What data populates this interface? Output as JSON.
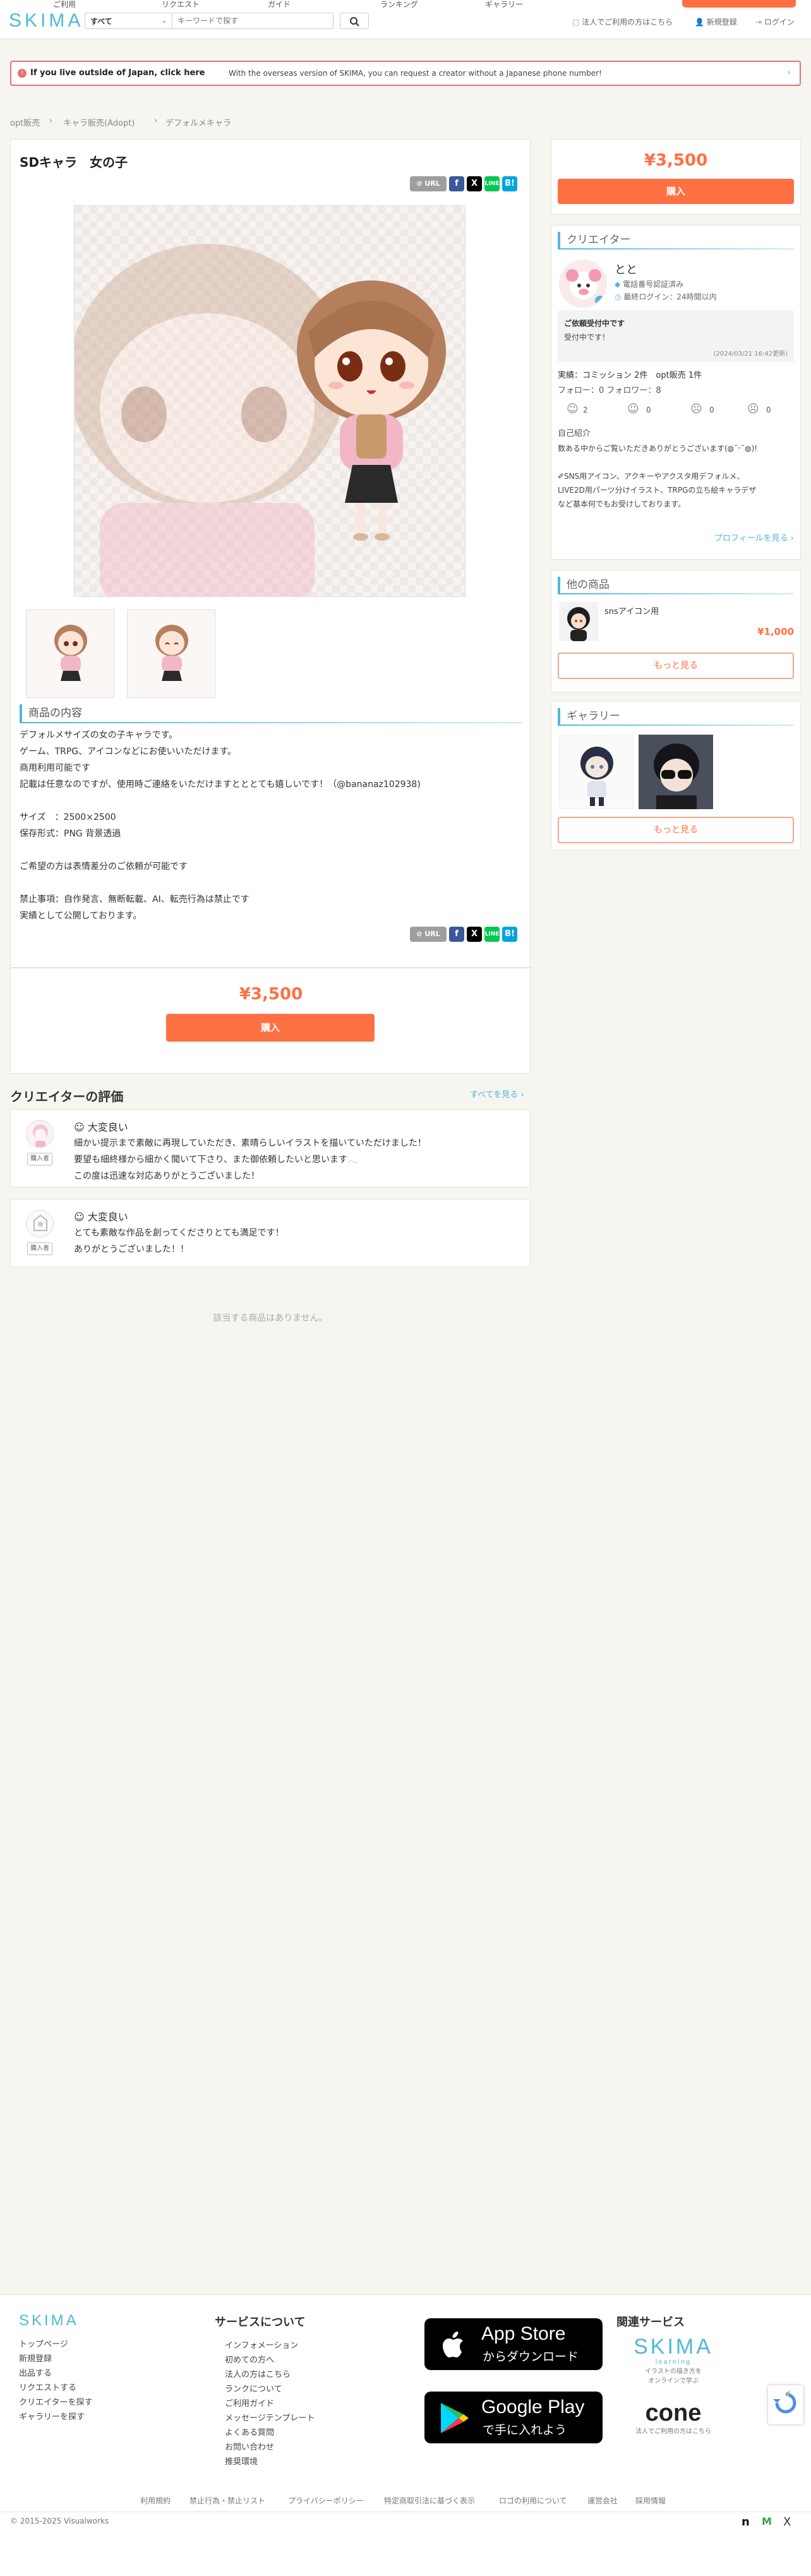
{
  "header": {
    "top_links": [
      "ご利用",
      "リクエスト",
      "ガイド",
      "ランキング",
      "ギャラリー"
    ],
    "logo": "SKIMA",
    "category_value": "すべて",
    "search_placeholder": "キーワードで探す",
    "corporate_link": "法人でご利用の方はこちら",
    "register_link": "新規登録",
    "login_link": "ログイン"
  },
  "banner": {
    "strong": "If you live outside of Japan, click here",
    "text": "With the overseas version of SKIMA, you can request a creator without a Japanese phone number!"
  },
  "breadcrumb": [
    "opt販売",
    "キャラ販売(Adopt)",
    "デフォルメキャラ"
  ],
  "product": {
    "title": "SDキャラ　女の子",
    "url_label": "URL",
    "section_title": "商品の内容",
    "description": [
      "デフォルメサイズの女の子キャラです。",
      "ゲーム、TRPG、アイコンなどにお使いいただけます。",
      "商用利用可能です",
      "記載は任意なのですが、使用時ご連絡をいただけますとととても嬉しいです！（@bananaz102938)",
      "",
      "サイズ　：2500×2500",
      "保存形式：PNG 背景透過",
      "",
      "ご希望の方は表情差分のご依頼が可能です",
      "",
      "禁止事項：自作発言、無断転載、AI、転売行為は禁止です",
      "実績として公開しております。"
    ],
    "price": "¥3,500",
    "buy_label": "購入"
  },
  "sidebar": {
    "price": "¥3,500",
    "buy_label": "購入",
    "creator": {
      "section_title": "クリエイター",
      "name": "とと",
      "phone_verified": "電話番号認証済み",
      "last_login": "最終ログイン：24時間以内",
      "status_title": "ご依頼受付中です",
      "status_text": "受付中です！",
      "status_date": "(2024/03/21 16:42更新)",
      "stats": "実績：コミッション 2件　opt販売 1件",
      "follow": "フォロー：0 フォロワー：8",
      "ratings": [
        "2",
        "0",
        "0",
        "0"
      ],
      "intro_label": "自己紹介",
      "intro_lines": [
        "数ある中からご覧いただきありがとうございます(◍˘ᵕ˘◍)!",
        "",
        "✐SNS用アイコン、アクキーやアクスタ用デフォルメ、",
        "LIVE2D用パーツ分けイラスト、TRPGの立ち絵キャラデザ",
        "など基本何でもお受けしております。"
      ],
      "profile_link": "プロフィールを見る ›"
    },
    "other_products": {
      "section_title": "他の商品",
      "item_name": "snsアイコン用",
      "item_price": "¥1,000",
      "more_label": "もっと見る"
    },
    "gallery": {
      "section_title": "ギャラリー",
      "more_label": "もっと見る"
    }
  },
  "reviews": {
    "title": "クリエイターの評価",
    "see_all": "すべてを見る ›",
    "badge": "購入者",
    "items": [
      {
        "rating": "☺ 大変良い",
        "lines": [
          "細かい提示まで素敵に再現していただき、素晴らしいイラストを描いていただけました！",
          "要望も細終様から細かく聞いて下さり、また御依頼したいと思います𓂃",
          "この度は迅速な対応ありがとうございました！"
        ]
      },
      {
        "rating": "☺ 大変良い",
        "lines": [
          "とても素敵な作品を創ってくださりとても満足です！",
          "ありがとうございました！！"
        ]
      }
    ]
  },
  "related_empty": "該当する商品はありません。",
  "footer": {
    "logo": "SKIMA",
    "nav": [
      "トップページ",
      "新規登録",
      "出品する",
      "リクエストする",
      "クリエイターを探す",
      "ギャラリーを探す"
    ],
    "services_title": "サービスについて",
    "services": [
      "インフォメーション",
      "初めての方へ",
      "法人の方はこちら",
      "ランクについて",
      "ご利用ガイド",
      "メッセージテンプレート",
      "よくある質問",
      "お問い合わせ",
      "推奨環境"
    ],
    "appstore_big": "App Store",
    "appstore_small": "からダウンロード",
    "googleplay_big": "Google Play",
    "googleplay_small": "で手に入れよう",
    "related_title": "関連サービス",
    "related_skima": "SKIMA",
    "related_skima_sub": "learning",
    "related_skima_desc1": "イラストの描き方を",
    "related_skima_desc2": "オンラインで学ぶ",
    "related_cone": "cone",
    "related_cone_desc": "法人でご利用の方はこちら",
    "bottom_links": [
      "利用規約",
      "禁止行為・禁止リスト",
      "プライバシーポリシー",
      "特定商取引法に基づく表示",
      "ロゴの利用について",
      "運営会社",
      "採用情報"
    ],
    "copyright": "© 2015-2025 Visualworks"
  },
  "colors": {
    "accent": "#ff7043",
    "brand_blue": "#4fb8d9"
  }
}
